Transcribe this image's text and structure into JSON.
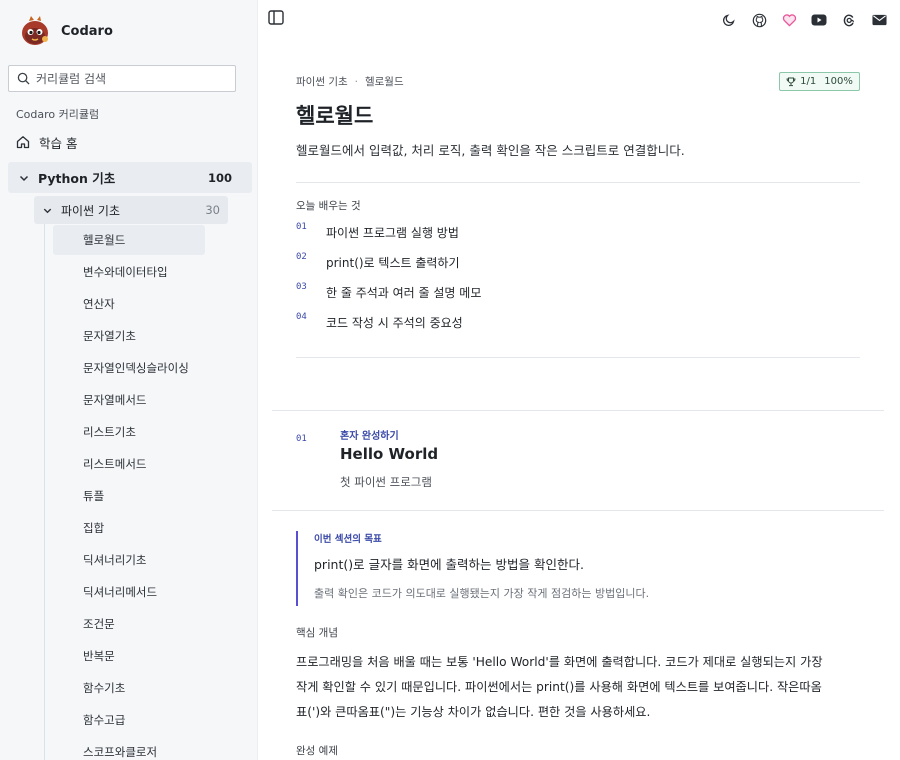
{
  "brand": {
    "name": "Codaro",
    "logo_icon": "mascot-logo-icon"
  },
  "search": {
    "placeholder": "커리큘럼 검색"
  },
  "sidebar": {
    "section_label": "Codaro 커리큘럼",
    "home_label": "학습 홈",
    "course": {
      "label": "Python 기초",
      "count": "100"
    },
    "module": {
      "label": "파이썬 기초",
      "count": "30"
    },
    "lessons": [
      "헬로월드",
      "변수와데이터타입",
      "연산자",
      "문자열기초",
      "문자열인덱싱슬라이싱",
      "문자열메서드",
      "리스트기초",
      "리스트메서드",
      "튜플",
      "집합",
      "딕셔너리기초",
      "딕셔너리메서드",
      "조건문",
      "반복문",
      "함수기초",
      "함수고급",
      "스코프와클로저"
    ],
    "active_lesson": 0
  },
  "topbar": {
    "icons": [
      "sidebar-toggle-icon",
      "moon-icon",
      "github-icon",
      "heart-icon",
      "youtube-icon",
      "threads-icon",
      "mail-icon"
    ],
    "heart_color": "#e8589b"
  },
  "lesson": {
    "breadcrumb": [
      "파이썬 기초",
      "헬로월드"
    ],
    "breadcrumb_sep": "·",
    "progress": {
      "count": "1/1",
      "percent": "100%"
    },
    "title": "헬로월드",
    "description": "헬로월드에서 입력값, 처리 로직, 출력 확인을 작은 스크립트로 연결합니다.",
    "learn_label": "오늘 배우는 것",
    "learn_items": [
      {
        "num": "01",
        "text": "파이썬 프로그램 실행 방법"
      },
      {
        "num": "02",
        "text": "print()로 텍스트 출력하기"
      },
      {
        "num": "03",
        "text": "한 줄 주석과 여러 줄 설명 메모"
      },
      {
        "num": "04",
        "text": "코드 작성 시 주석의 중요성"
      }
    ]
  },
  "section": {
    "num": "01",
    "kicker": "혼자 완성하기",
    "title": "Hello World",
    "subtitle": "첫 파이썬 프로그램",
    "goal_label": "이번 섹션의 목표",
    "goal_main": "print()로 글자를 화면에 출력하는 방법을 확인한다.",
    "goal_note": "출력 확인은 코드가 의도대로 실행됐는지 가장 작게 점검하는 방법입니다.",
    "core_label": "핵심 개념",
    "core_text": "프로그래밍을 처음 배울 때는 보통 'Hello World'를 화면에 출력합니다. 코드가 제대로 실행되는지 가장 작게 확인할 수 있기 때문입니다. 파이썬에서는 print()를 사용해 화면에 텍스트를 보여줍니다. 작은따옴표(')와 큰따옴표(\")는 기능상 차이가 없습니다. 편한 것을 사용하세요.",
    "example_label": "완성 예제"
  },
  "colors": {
    "accent": "#3b4aa8",
    "goal_bar": "#5a4ed1",
    "badge_border": "#8cc7a9"
  }
}
